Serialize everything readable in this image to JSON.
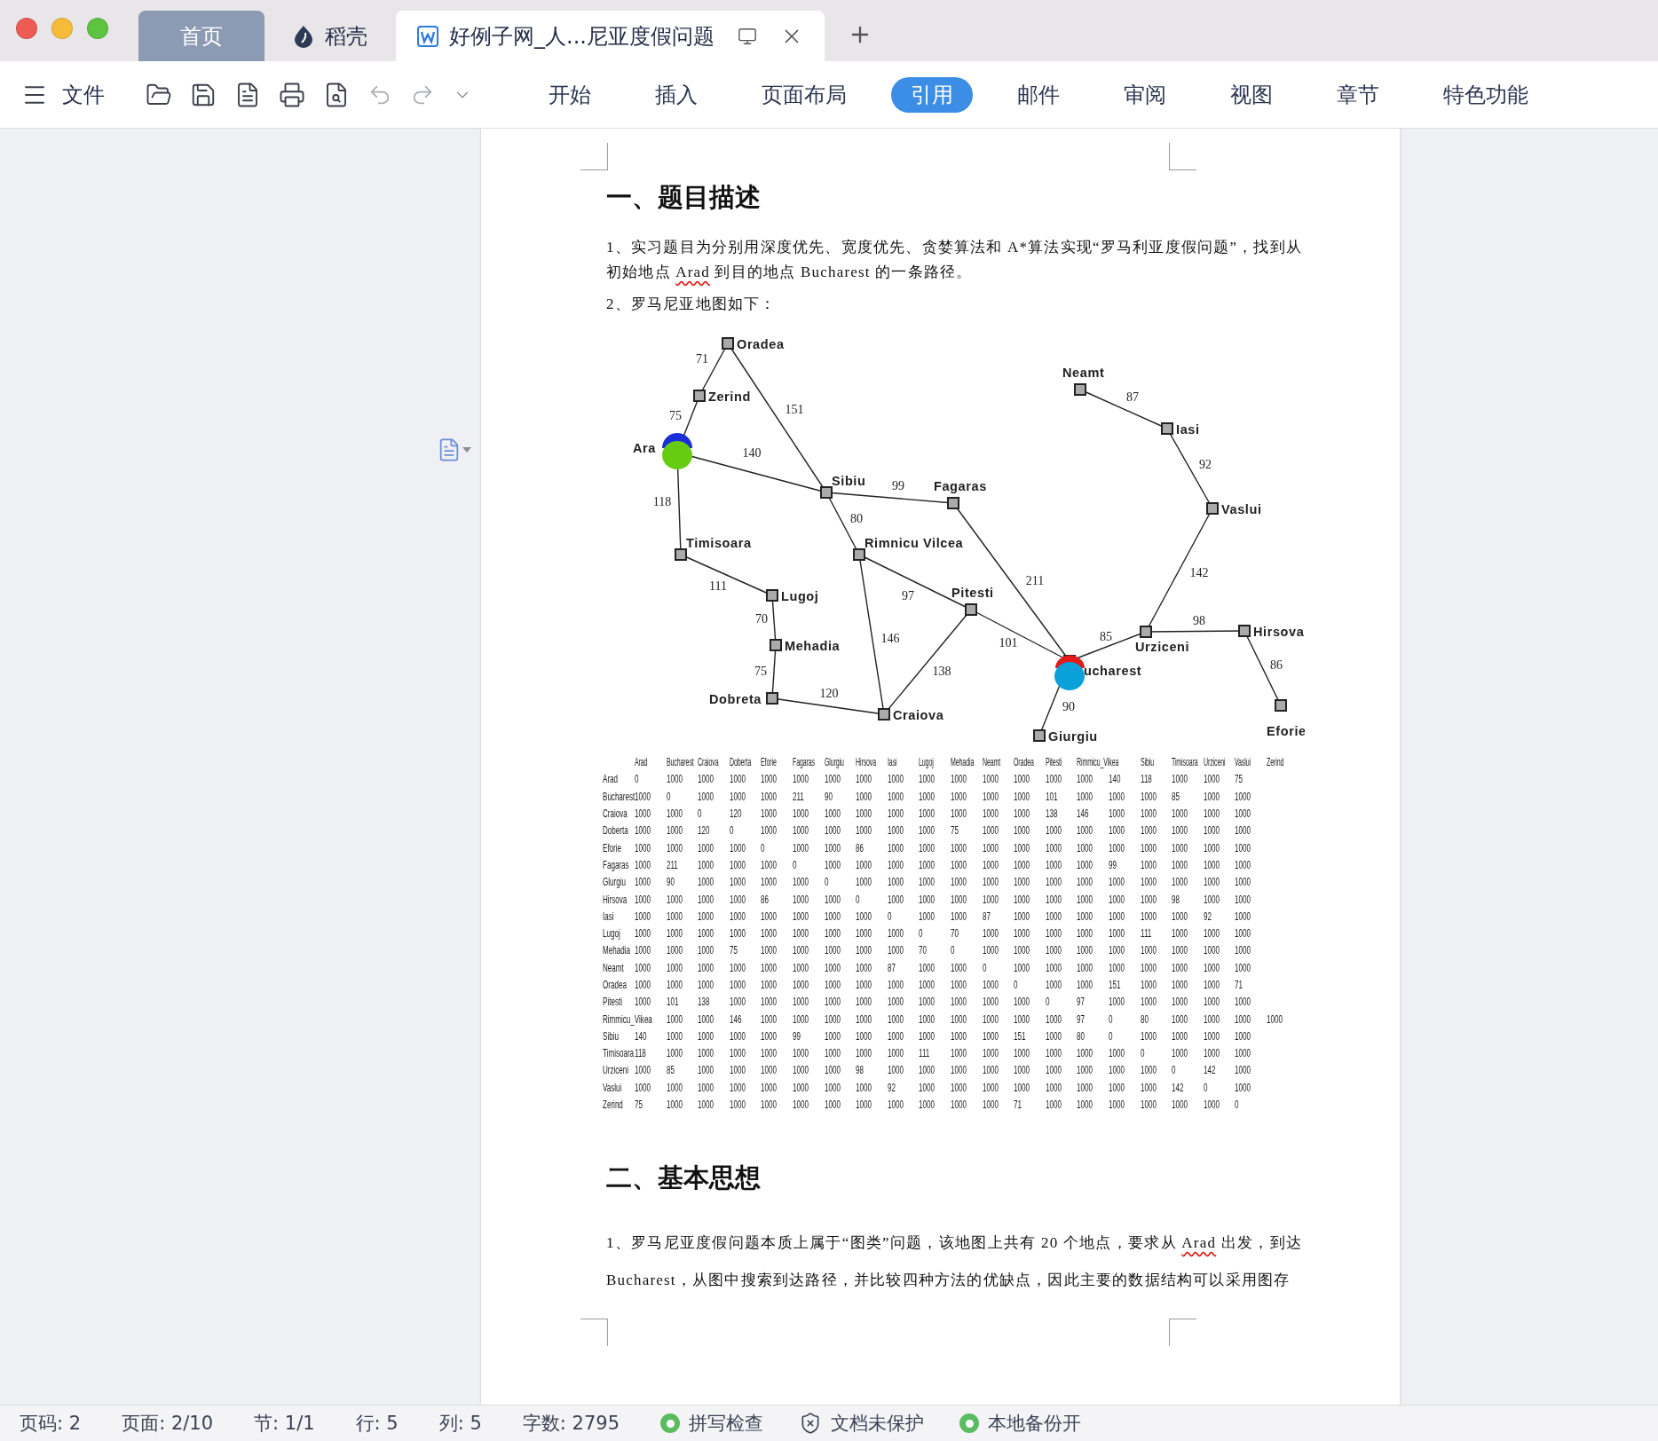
{
  "tabs": [
    {
      "label": "首页",
      "kind": "home",
      "selected": false
    },
    {
      "label": "稻壳",
      "kind": "docer",
      "selected": false
    },
    {
      "label": "好例子网_人...尼亚度假问题",
      "kind": "document",
      "selected": true
    }
  ],
  "toolbar": {
    "file_menu": "文件",
    "ribbon_tabs": [
      {
        "label": "开始",
        "selected": false
      },
      {
        "label": "插入",
        "selected": false
      },
      {
        "label": "页面布局",
        "selected": false
      },
      {
        "label": "引用",
        "selected": true
      },
      {
        "label": "邮件",
        "selected": false
      },
      {
        "label": "审阅",
        "selected": false
      },
      {
        "label": "视图",
        "selected": false
      },
      {
        "label": "章节",
        "selected": false
      },
      {
        "label": "特色功能",
        "selected": false
      }
    ]
  },
  "document": {
    "blocks": [
      {
        "kind": "heading",
        "text": "一、题目描述"
      },
      {
        "kind": "paragraph",
        "segments": [
          {
            "text": "1、实习题目为分别用深度优先、宽度优先、贪婪算法和 A*算法实现“罗马利亚度假问题”，找到从初始地点 ",
            "misspelled": false
          },
          {
            "text": "Arad",
            "misspelled": true
          },
          {
            "text": " 到目的地点 Bucharest 的一条路径。",
            "misspelled": false
          }
        ]
      },
      {
        "kind": "paragraph",
        "segments": [
          {
            "text": "2、罗马尼亚地图如下：",
            "misspelled": false
          }
        ]
      },
      {
        "kind": "map",
        "nodes": [
          {
            "label": "Oradea"
          },
          {
            "label": "Zerind"
          },
          {
            "label": "Ara"
          },
          {
            "label": "Sibiu"
          },
          {
            "label": "Fagaras"
          },
          {
            "label": "Rimnicu Vilcea"
          },
          {
            "label": "Timisoara"
          },
          {
            "label": "Lugoj"
          },
          {
            "label": "Mehadia"
          },
          {
            "label": "Dobreta"
          },
          {
            "label": "Craiova"
          },
          {
            "label": "Pitesti"
          },
          {
            "label": "ucharest"
          },
          {
            "label": "Giurgiu"
          },
          {
            "label": "Urziceni"
          },
          {
            "label": "Hirsova"
          },
          {
            "label": "Eforie"
          },
          {
            "label": "Vaslui"
          },
          {
            "label": "Iasi"
          },
          {
            "label": "Neamt"
          }
        ],
        "edges": [
          {
            "label": "71"
          },
          {
            "label": "151"
          },
          {
            "label": "75"
          },
          {
            "label": "140"
          },
          {
            "label": "118"
          },
          {
            "label": "111"
          },
          {
            "label": "70"
          },
          {
            "label": "75"
          },
          {
            "label": "120"
          },
          {
            "label": "99"
          },
          {
            "label": "80"
          },
          {
            "label": "97"
          },
          {
            "label": "146"
          },
          {
            "label": "138"
          },
          {
            "label": "101"
          },
          {
            "label": "211"
          },
          {
            "label": "90"
          },
          {
            "label": "85"
          },
          {
            "label": "98"
          },
          {
            "label": "86"
          },
          {
            "label": "87"
          },
          {
            "label": "92"
          },
          {
            "label": "142"
          }
        ]
      },
      {
        "kind": "table",
        "columns": [
          "",
          "Arad",
          "Bucharest",
          "Craiova",
          "Doberta",
          "Eforie",
          "Fagaras",
          "Glurgiu",
          "Hirsova",
          "Iasi",
          "Lugoj",
          "Mehadia",
          "Neamt",
          "Oradea",
          "Pitesti",
          "Rimmicu_Vikea",
          "",
          "Sibiu",
          "Timisoara",
          "Urziceni",
          "Vaslui",
          "Zerind"
        ],
        "rows": [
          [
            "Arad",
            "0",
            "1000",
            "1000",
            "1000",
            "1000",
            "1000",
            "1000",
            "1000",
            "1000",
            "1000",
            "1000",
            "1000",
            "1000",
            "1000",
            "1000",
            "140",
            "118",
            "1000",
            "1000",
            "75"
          ],
          [
            "Bucharest",
            "1000",
            "0",
            "1000",
            "1000",
            "1000",
            "211",
            "90",
            "1000",
            "1000",
            "1000",
            "1000",
            "1000",
            "1000",
            "101",
            "1000",
            "1000",
            "1000",
            "85",
            "1000",
            "1000"
          ],
          [
            "Craiova",
            "1000",
            "1000",
            "0",
            "120",
            "1000",
            "1000",
            "1000",
            "1000",
            "1000",
            "1000",
            "1000",
            "1000",
            "1000",
            "138",
            "146",
            "1000",
            "1000",
            "1000",
            "1000",
            "1000"
          ],
          [
            "Doberta",
            "1000",
            "1000",
            "120",
            "0",
            "1000",
            "1000",
            "1000",
            "1000",
            "1000",
            "1000",
            "75",
            "1000",
            "1000",
            "1000",
            "1000",
            "1000",
            "1000",
            "1000",
            "1000",
            "1000"
          ],
          [
            "Eforie",
            "1000",
            "1000",
            "1000",
            "1000",
            "0",
            "1000",
            "1000",
            "86",
            "1000",
            "1000",
            "1000",
            "1000",
            "1000",
            "1000",
            "1000",
            "1000",
            "1000",
            "1000",
            "1000",
            "1000"
          ],
          [
            "Fagaras",
            "1000",
            "211",
            "1000",
            "1000",
            "1000",
            "0",
            "1000",
            "1000",
            "1000",
            "1000",
            "1000",
            "1000",
            "1000",
            "1000",
            "1000",
            "99",
            "1000",
            "1000",
            "1000",
            "1000"
          ],
          [
            "Glurgiu",
            "1000",
            "90",
            "1000",
            "1000",
            "1000",
            "1000",
            "0",
            "1000",
            "1000",
            "1000",
            "1000",
            "1000",
            "1000",
            "1000",
            "1000",
            "1000",
            "1000",
            "1000",
            "1000",
            "1000"
          ],
          [
            "Hirsova",
            "1000",
            "1000",
            "1000",
            "1000",
            "86",
            "1000",
            "1000",
            "0",
            "1000",
            "1000",
            "1000",
            "1000",
            "1000",
            "1000",
            "1000",
            "1000",
            "1000",
            "98",
            "1000",
            "1000"
          ],
          [
            "Iasi",
            "1000",
            "1000",
            "1000",
            "1000",
            "1000",
            "1000",
            "1000",
            "1000",
            "0",
            "1000",
            "1000",
            "87",
            "1000",
            "1000",
            "1000",
            "1000",
            "1000",
            "1000",
            "92",
            "1000"
          ],
          [
            "Lugoj",
            "1000",
            "1000",
            "1000",
            "1000",
            "1000",
            "1000",
            "1000",
            "1000",
            "1000",
            "0",
            "70",
            "1000",
            "1000",
            "1000",
            "1000",
            "1000",
            "111",
            "1000",
            "1000",
            "1000"
          ],
          [
            "Mehadia",
            "1000",
            "1000",
            "1000",
            "75",
            "1000",
            "1000",
            "1000",
            "1000",
            "1000",
            "70",
            "0",
            "1000",
            "1000",
            "1000",
            "1000",
            "1000",
            "1000",
            "1000",
            "1000",
            "1000"
          ],
          [
            "Neamt",
            "1000",
            "1000",
            "1000",
            "1000",
            "1000",
            "1000",
            "1000",
            "1000",
            "87",
            "1000",
            "1000",
            "0",
            "1000",
            "1000",
            "1000",
            "1000",
            "1000",
            "1000",
            "1000",
            "1000"
          ],
          [
            "Oradea",
            "1000",
            "1000",
            "1000",
            "1000",
            "1000",
            "1000",
            "1000",
            "1000",
            "1000",
            "1000",
            "1000",
            "1000",
            "0",
            "1000",
            "1000",
            "151",
            "1000",
            "1000",
            "1000",
            "71"
          ],
          [
            "Pitesti",
            "1000",
            "101",
            "138",
            "1000",
            "1000",
            "1000",
            "1000",
            "1000",
            "1000",
            "1000",
            "1000",
            "1000",
            "1000",
            "0",
            "97",
            "1000",
            "1000",
            "1000",
            "1000",
            "1000"
          ],
          [
            "Rimmicu_Vikea",
            "",
            "1000",
            "1000",
            "146",
            "1000",
            "1000",
            "1000",
            "1000",
            "1000",
            "1000",
            "1000",
            "1000",
            "1000",
            "1000",
            "97",
            "0",
            "80",
            "1000",
            "1000",
            "1000",
            "1000"
          ],
          [
            "Sibiu",
            "140",
            "1000",
            "1000",
            "1000",
            "1000",
            "99",
            "1000",
            "1000",
            "1000",
            "1000",
            "1000",
            "1000",
            "151",
            "1000",
            "80",
            "0",
            "1000",
            "1000",
            "1000",
            "1000"
          ],
          [
            "Timisoara",
            "118",
            "1000",
            "1000",
            "1000",
            "1000",
            "1000",
            "1000",
            "1000",
            "1000",
            "111",
            "1000",
            "1000",
            "1000",
            "1000",
            "1000",
            "1000",
            "0",
            "1000",
            "1000",
            "1000"
          ],
          [
            "Urziceni",
            "1000",
            "85",
            "1000",
            "1000",
            "1000",
            "1000",
            "1000",
            "98",
            "1000",
            "1000",
            "1000",
            "1000",
            "1000",
            "1000",
            "1000",
            "1000",
            "1000",
            "0",
            "142",
            "1000"
          ],
          [
            "Vaslui",
            "1000",
            "1000",
            "1000",
            "1000",
            "1000",
            "1000",
            "1000",
            "1000",
            "92",
            "1000",
            "1000",
            "1000",
            "1000",
            "1000",
            "1000",
            "1000",
            "1000",
            "142",
            "0",
            "1000"
          ],
          [
            "Zerind",
            "75",
            "1000",
            "1000",
            "1000",
            "1000",
            "1000",
            "1000",
            "1000",
            "1000",
            "1000",
            "1000",
            "1000",
            "71",
            "1000",
            "1000",
            "1000",
            "1000",
            "1000",
            "1000",
            "0"
          ]
        ]
      },
      {
        "kind": "heading",
        "text": "二、基本思想"
      },
      {
        "kind": "loose_paragraph",
        "segments": [
          {
            "text": "1、罗马尼亚度假问题本质上属于“图类”问题，该地图上共有 20 个地点，要求从 ",
            "misspelled": false
          },
          {
            "text": "Arad",
            "misspelled": true
          },
          {
            "text": " 出发，到达 Bucharest，从图中搜索到达路径，并比较四种方法的优缺点，因此主要的数据结构可以采用图存",
            "misspelled": false
          }
        ]
      }
    ]
  },
  "status_bar": [
    {
      "kind": "text",
      "label": "页码: 2"
    },
    {
      "kind": "text",
      "label": "页面: 2/10"
    },
    {
      "kind": "text",
      "label": "节: 1/1"
    },
    {
      "kind": "text",
      "label": "行: 5"
    },
    {
      "kind": "text",
      "label": "列: 5"
    },
    {
      "kind": "text",
      "label": "字数: 2795"
    },
    {
      "kind": "check",
      "label": "拼写检查"
    },
    {
      "kind": "shield",
      "label": "文档未保护"
    },
    {
      "kind": "check",
      "label": "本地备份开"
    }
  ]
}
